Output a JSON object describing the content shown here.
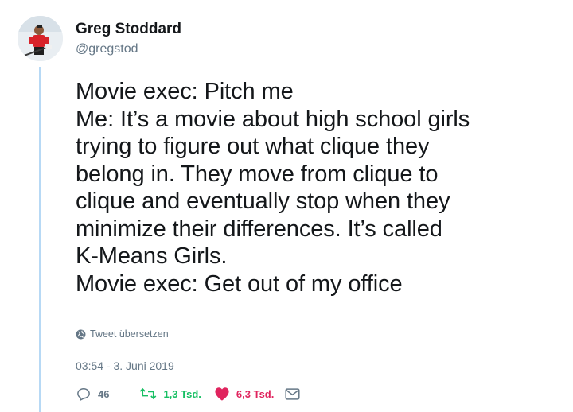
{
  "user": {
    "name": "Greg Stoddard",
    "handle": "@gregstod"
  },
  "tweet": {
    "lines": [
      "Movie exec: Pitch me",
      "Me: It’s a movie about high school girls",
      "trying to figure out what clique they",
      "belong in. They move from clique to",
      "clique and eventually stop when they",
      "minimize their differences. It’s called",
      "K-Means Girls.",
      "Movie exec: Get out of my office"
    ],
    "translate_label": "Tweet übersetzen",
    "timestamp": "03:54 - 3. Juni 2019"
  },
  "actions": {
    "replies": "46",
    "retweets": "1,3 Tsd.",
    "likes": "6,3 Tsd."
  },
  "colors": {
    "retweet": "#17bf63",
    "like": "#e0245e",
    "muted": "#657786",
    "thread_line": "#b7d9f5"
  },
  "icons": [
    "globe-icon",
    "reply-icon",
    "retweet-icon",
    "heart-icon",
    "direct-message-icon"
  ]
}
